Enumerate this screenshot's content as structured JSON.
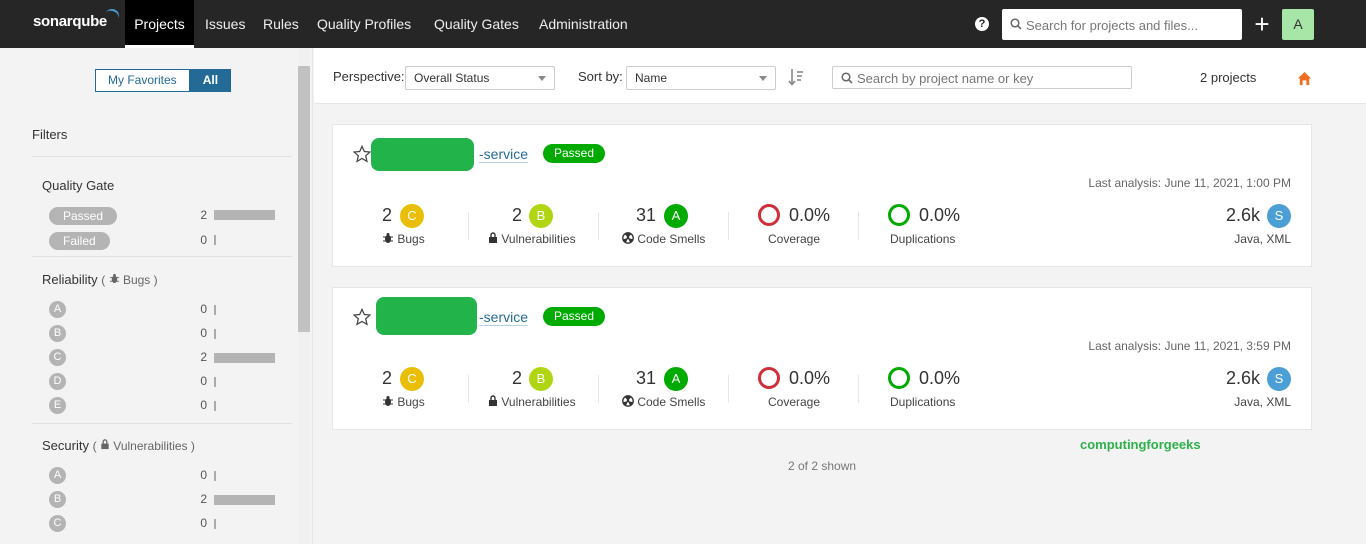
{
  "app": {
    "logo": "sonarqube",
    "nav": [
      "Projects",
      "Issues",
      "Rules",
      "Quality Profiles",
      "Quality Gates",
      "Administration"
    ],
    "search_placeholder": "Search for projects and files...",
    "help": "?",
    "plus": "+",
    "avatar": "A"
  },
  "sidebar": {
    "toggle": [
      "My Favorites",
      "All"
    ],
    "filters_title": "Filters",
    "quality_gate": {
      "title": "Quality Gate",
      "items": [
        {
          "label": "Passed",
          "count": "2",
          "fraction": 1.0
        },
        {
          "label": "Failed",
          "count": "0",
          "fraction": 0
        }
      ]
    },
    "reliability": {
      "title": "Reliability",
      "sub": "Bugs",
      "items": [
        {
          "label": "A",
          "count": "0",
          "fraction": 0
        },
        {
          "label": "B",
          "count": "0",
          "fraction": 0
        },
        {
          "label": "C",
          "count": "2",
          "fraction": 1.0
        },
        {
          "label": "D",
          "count": "0",
          "fraction": 0
        },
        {
          "label": "E",
          "count": "0",
          "fraction": 0
        }
      ]
    },
    "security": {
      "title": "Security",
      "sub": "Vulnerabilities",
      "items": [
        {
          "label": "A",
          "count": "0",
          "fraction": 0
        },
        {
          "label": "B",
          "count": "2",
          "fraction": 1.0
        },
        {
          "label": "C",
          "count": "0",
          "fraction": 0
        }
      ]
    }
  },
  "toolbar": {
    "perspective_label": "Perspective:",
    "perspective_value": "Overall Status",
    "sort_label": "Sort by:",
    "sort_value": "Name",
    "search_placeholder": "Search by project name or key",
    "project_count": "2 projects"
  },
  "projects": [
    {
      "name": "-service",
      "gate": "Passed",
      "last_analysis": "Last analysis: June 11, 2021, 1:00 PM",
      "bugs": {
        "value": "2",
        "rating": "C",
        "label": "Bugs"
      },
      "vulnerabilities": {
        "value": "2",
        "rating": "B",
        "label": "Vulnerabilities"
      },
      "code_smells": {
        "value": "31",
        "rating": "A",
        "label": "Code Smells"
      },
      "coverage": {
        "value": "0.0%",
        "label": "Coverage"
      },
      "duplications": {
        "value": "0.0%",
        "label": "Duplications"
      },
      "size": {
        "value": "2.6k",
        "rating": "S",
        "languages": "Java, XML"
      }
    },
    {
      "name": "-service",
      "gate": "Passed",
      "last_analysis": "Last analysis: June 11, 2021, 3:59 PM",
      "bugs": {
        "value": "2",
        "rating": "C",
        "label": "Bugs"
      },
      "vulnerabilities": {
        "value": "2",
        "rating": "B",
        "label": "Vulnerabilities"
      },
      "code_smells": {
        "value": "31",
        "rating": "A",
        "label": "Code Smells"
      },
      "coverage": {
        "value": "0.0%",
        "label": "Coverage"
      },
      "duplications": {
        "value": "0.0%",
        "label": "Duplications"
      },
      "size": {
        "value": "2.6k",
        "rating": "S",
        "languages": "Java, XML"
      }
    }
  ],
  "watermark": "computingforgeeks",
  "shown": "2 of 2 shown",
  "colors": {
    "accent": "#236a97",
    "passed": "#00aa00",
    "rating_c": "#eabe06",
    "rating_b": "#b0d513",
    "home": "#f26d21"
  }
}
